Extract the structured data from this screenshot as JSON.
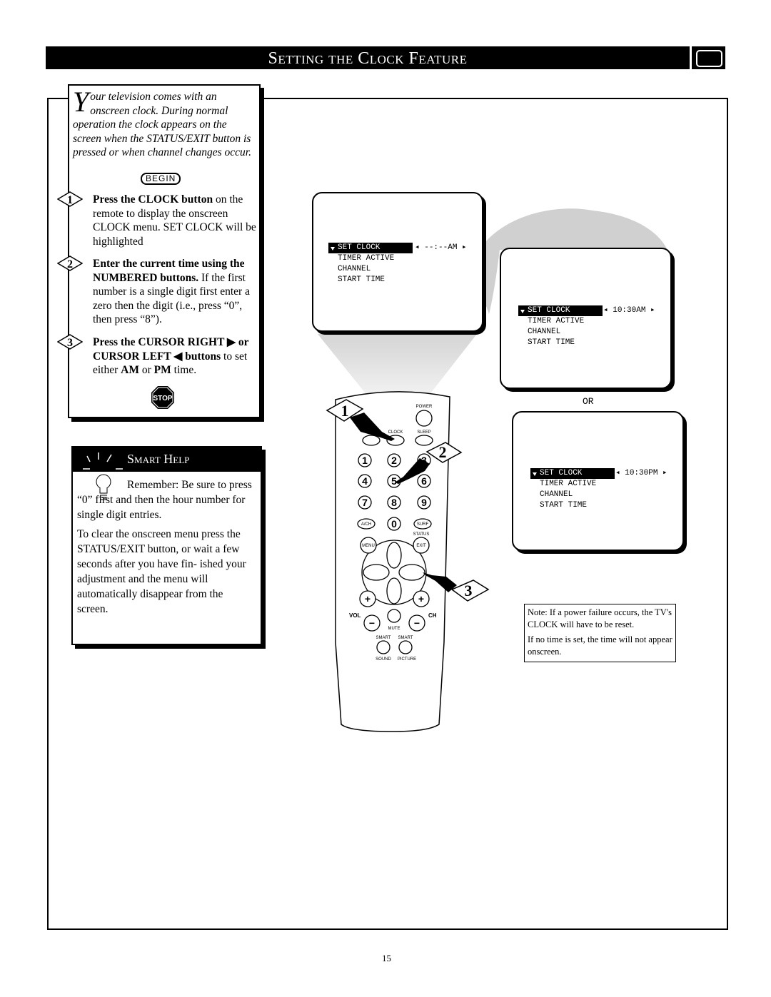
{
  "title": "Setting the Clock Feature",
  "icons": {
    "title_right": "tv-icon",
    "stop": "stop-sign-icon",
    "smart_help": "light-bulb-icon"
  },
  "intro": {
    "drop_cap": "Y",
    "text": "our television comes with an onscreen clock. During normal operation the clock appears on the screen when the STATUS/EXIT button is pressed or when channel changes occur.",
    "begin_label": "BEGIN"
  },
  "steps": [
    {
      "number": "1",
      "bold": "Press the CLOCK button",
      "text": " on the remote to display the onscreen CLOCK menu. SET CLOCK will be highlighted"
    },
    {
      "number": "2",
      "bold": "Enter the current time using the NUMBERED buttons.",
      "text": " If the first number is a single digit first enter a zero then the digit (i.e., press “0”, then press “8”)."
    },
    {
      "number": "3",
      "bold": "Press the CURSOR RIGHT ▶ or CURSOR LEFT ◀ buttons",
      "text": " to set either ",
      "am": "AM",
      "or": " or ",
      "pm": "PM",
      "end": " time."
    }
  ],
  "stop_label": "STOP",
  "smart_help": {
    "title": "Smart Help",
    "p1": "Remember: Be sure to press “0” first and then the hour number for single digit entries.",
    "p2": "To clear the onscreen menu press the STATUS/EXIT button, or wait a few seconds after you have fin- ished your adjustment and the menu will automatically disappear from the screen."
  },
  "menu_items": [
    "SET CLOCK",
    "TIMER ACTIVE",
    "CHANNEL",
    "START TIME"
  ],
  "screens": [
    {
      "value": "--:--AM"
    },
    {
      "value": "10:30AM"
    },
    {
      "value": "10:30PM"
    }
  ],
  "or_label": "OR",
  "remote": {
    "buttons": [
      "POWER",
      "CLOCK",
      "SLEEP",
      "1",
      "2",
      "3",
      "4",
      "5",
      "6",
      "7",
      "8",
      "9",
      "A/CH",
      "0",
      "SURF",
      "STATUS",
      "MENU",
      "EXIT",
      "VOL",
      "CH",
      "MUTE",
      "SMART",
      "SMART",
      "SOUND",
      "PICTURE"
    ],
    "callouts": [
      "1",
      "2",
      "3"
    ]
  },
  "note": {
    "p1": "Note: If a power failure occurs, the TV's CLOCK will have to be reset.",
    "p2": "If no time is set, the time will not appear onscreen."
  },
  "page_number": "15"
}
